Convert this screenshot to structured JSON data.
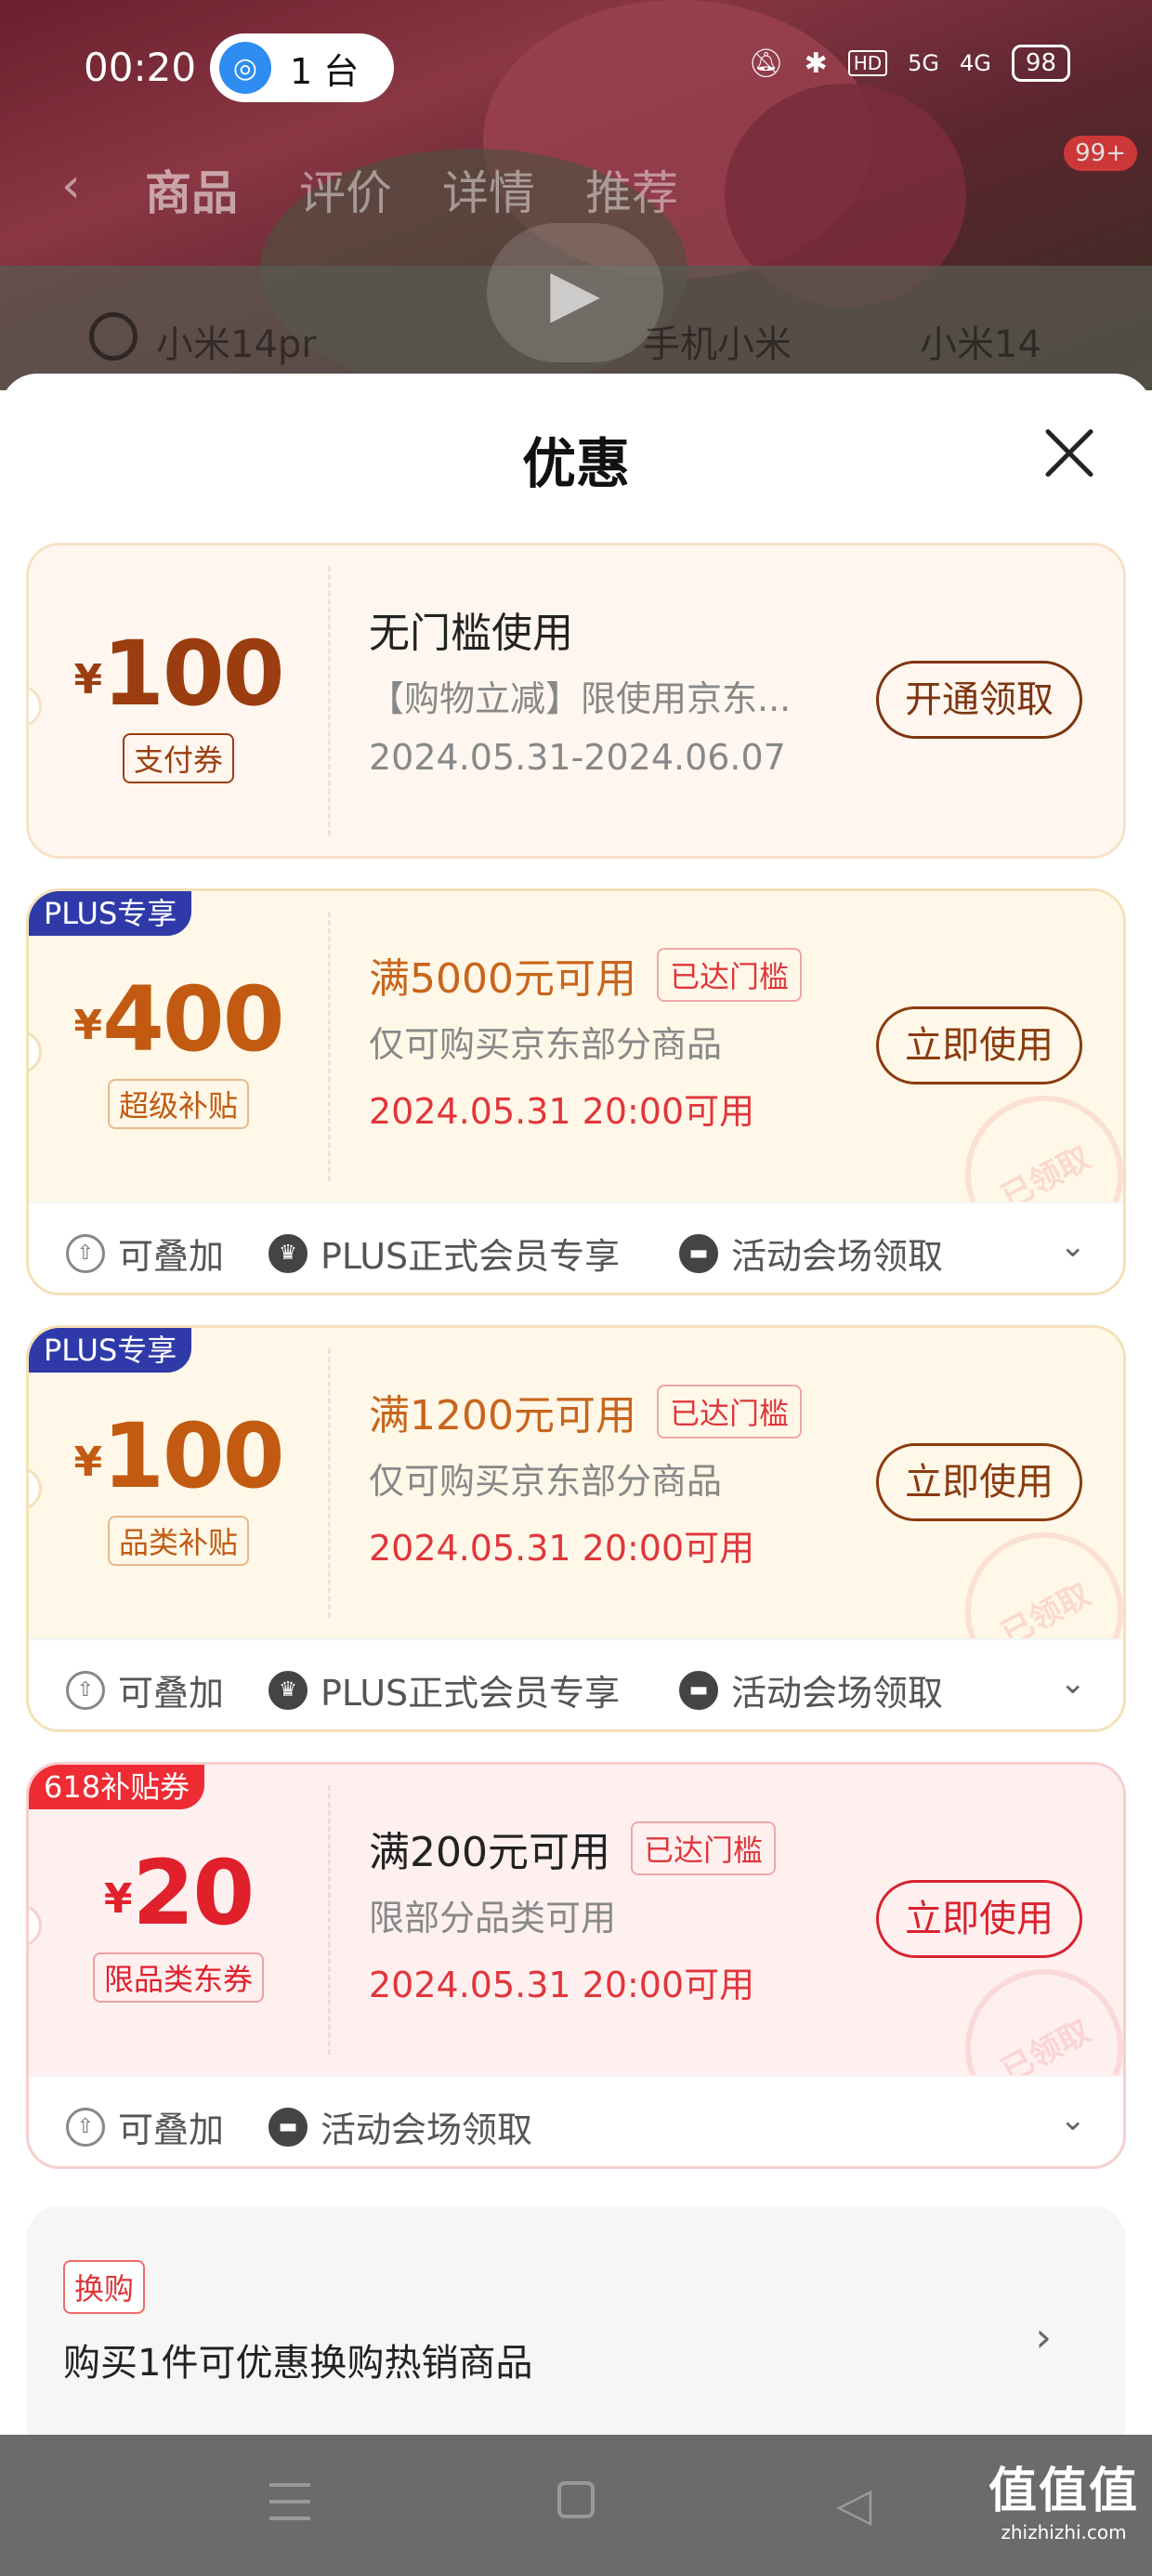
{
  "status_bar": {
    "time": "00:20",
    "hotspot_count": "1 台",
    "network": "5G",
    "network2": "4G",
    "battery": "98"
  },
  "product_page": {
    "tabs": [
      "商品",
      "评价",
      "详情",
      "推荐"
    ],
    "cart_badge": "99+",
    "search_text": "小米14pr",
    "suggestions": [
      "手机小米",
      "小米14"
    ]
  },
  "sheet": {
    "title": "优惠"
  },
  "coupons": [
    {
      "currency": "¥",
      "amount": "100",
      "type_label": "支付券",
      "title": "无门槛使用",
      "desc": "【购物立减】限使用京东...",
      "validity": "2024.05.31-2024.06.07",
      "button": "开通领取"
    },
    {
      "tag": "PLUS专享",
      "currency": "¥",
      "amount": "400",
      "type_label": "超级补贴",
      "title": "满5000元可用",
      "reached": "已达门槛",
      "desc": "仅可购买京东部分商品",
      "validity": "2024.05.31 20:00可用",
      "button": "立即使用",
      "stamp": "已领取",
      "features": [
        "可叠加",
        "PLUS正式会员专享",
        "活动会场领取"
      ]
    },
    {
      "tag": "PLUS专享",
      "currency": "¥",
      "amount": "100",
      "type_label": "品类补贴",
      "title": "满1200元可用",
      "reached": "已达门槛",
      "desc": "仅可购买京东部分商品",
      "validity": "2024.05.31 20:00可用",
      "button": "立即使用",
      "stamp": "已领取",
      "features": [
        "可叠加",
        "PLUS正式会员专享",
        "活动会场领取"
      ]
    },
    {
      "tag": "618补贴券",
      "currency": "¥",
      "amount": "20",
      "type_label": "限品类东券",
      "title": "满200元可用",
      "reached": "已达门槛",
      "desc": "限部分品类可用",
      "validity": "2024.05.31 20:00可用",
      "button": "立即使用",
      "stamp": "已领取",
      "features": [
        "可叠加",
        "活动会场领取"
      ]
    }
  ],
  "swap": {
    "badge": "换购",
    "text": "购买1件可优惠换购热销商品"
  },
  "watermark": {
    "brand": "值值值",
    "domain": "zhizhizhi.com"
  },
  "colors": {
    "plus_tag": "#2f3aa8",
    "red_accent": "#e0363b",
    "plus_amount": "#c25a12"
  }
}
